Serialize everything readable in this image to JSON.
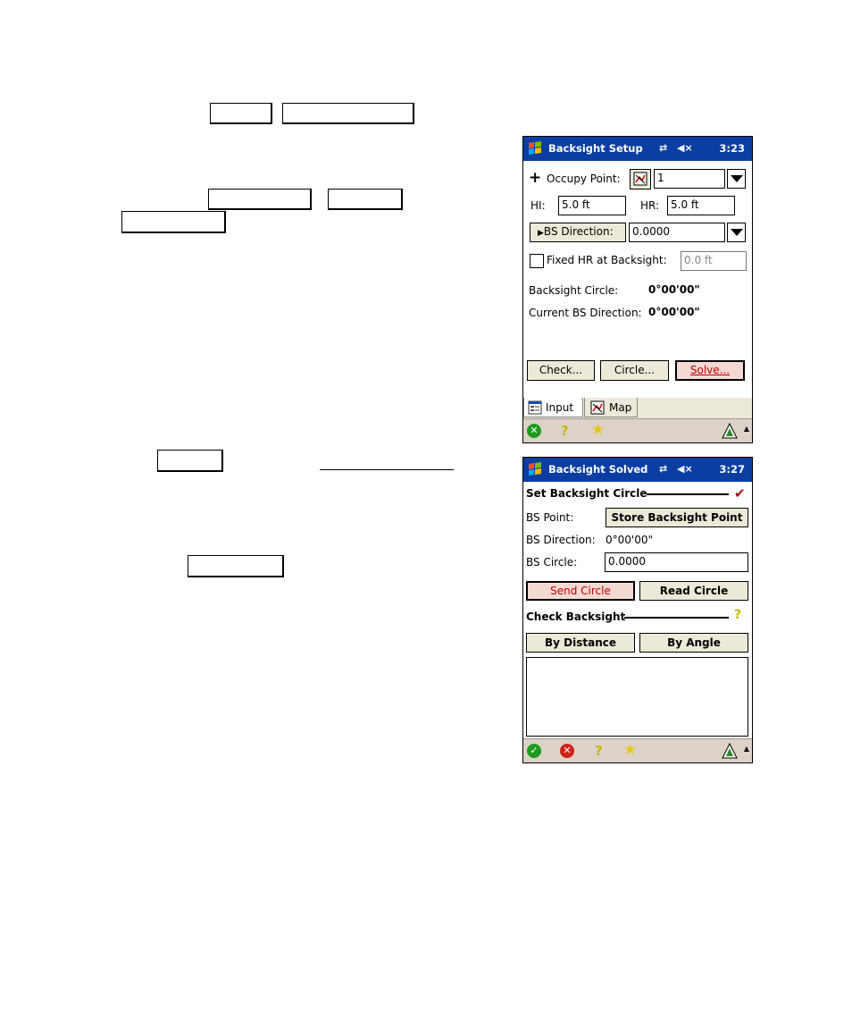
{
  "screen1": {
    "title": "Backsight Setup",
    "time": "3:23",
    "occupy_point_label": "Occupy Point:",
    "occupy_point_value": "1",
    "hi_label": "HI:",
    "hi_value": "5.0 ft",
    "hr_label": "HR:",
    "hr_value": "5.0 ft",
    "bs_direction_button": "BS Direction:",
    "bs_direction_value": "0.0000",
    "fixed_hr_label": "Fixed HR at Backsight:",
    "fixed_hr_value": "0.0 ft",
    "backsight_circle_label": "Backsight Circle:",
    "backsight_circle_value": "0°00'00\"",
    "current_bs_direction_label": "Current BS Direction:",
    "current_bs_direction_value": "0°00'00\"",
    "check_button": "Check...",
    "circle_button": "Circle...",
    "solve_button": "Solve...",
    "tab_input": "Input",
    "tab_map": "Map"
  },
  "screen2": {
    "title": "Backsight Solved",
    "time": "3:27",
    "set_backsight_circle": "Set Backsight Circle",
    "bs_point_label": "BS Point:",
    "store_backsight_button": "Store Backsight Point",
    "bs_direction_label": "BS Direction:",
    "bs_direction_value": "0°00'00\"",
    "bs_circle_label": "BS Circle:",
    "bs_circle_value": "0.0000",
    "send_circle_button": "Send Circle",
    "read_circle_button": "Read Circle",
    "check_backsight": "Check Backsight",
    "by_distance_button": "By Distance",
    "by_angle_button": "By Angle"
  },
  "colors": {
    "titlebar": "#0a3ea2",
    "accent_red": "#c00000",
    "button_face": "#ece9d8"
  },
  "icons": [
    "windows-logo-icon",
    "connection-icon",
    "speaker-mute-icon",
    "map-icon",
    "ok-icon",
    "cancel-icon",
    "help-icon",
    "favorites-icon",
    "carlson-logo-icon"
  ]
}
